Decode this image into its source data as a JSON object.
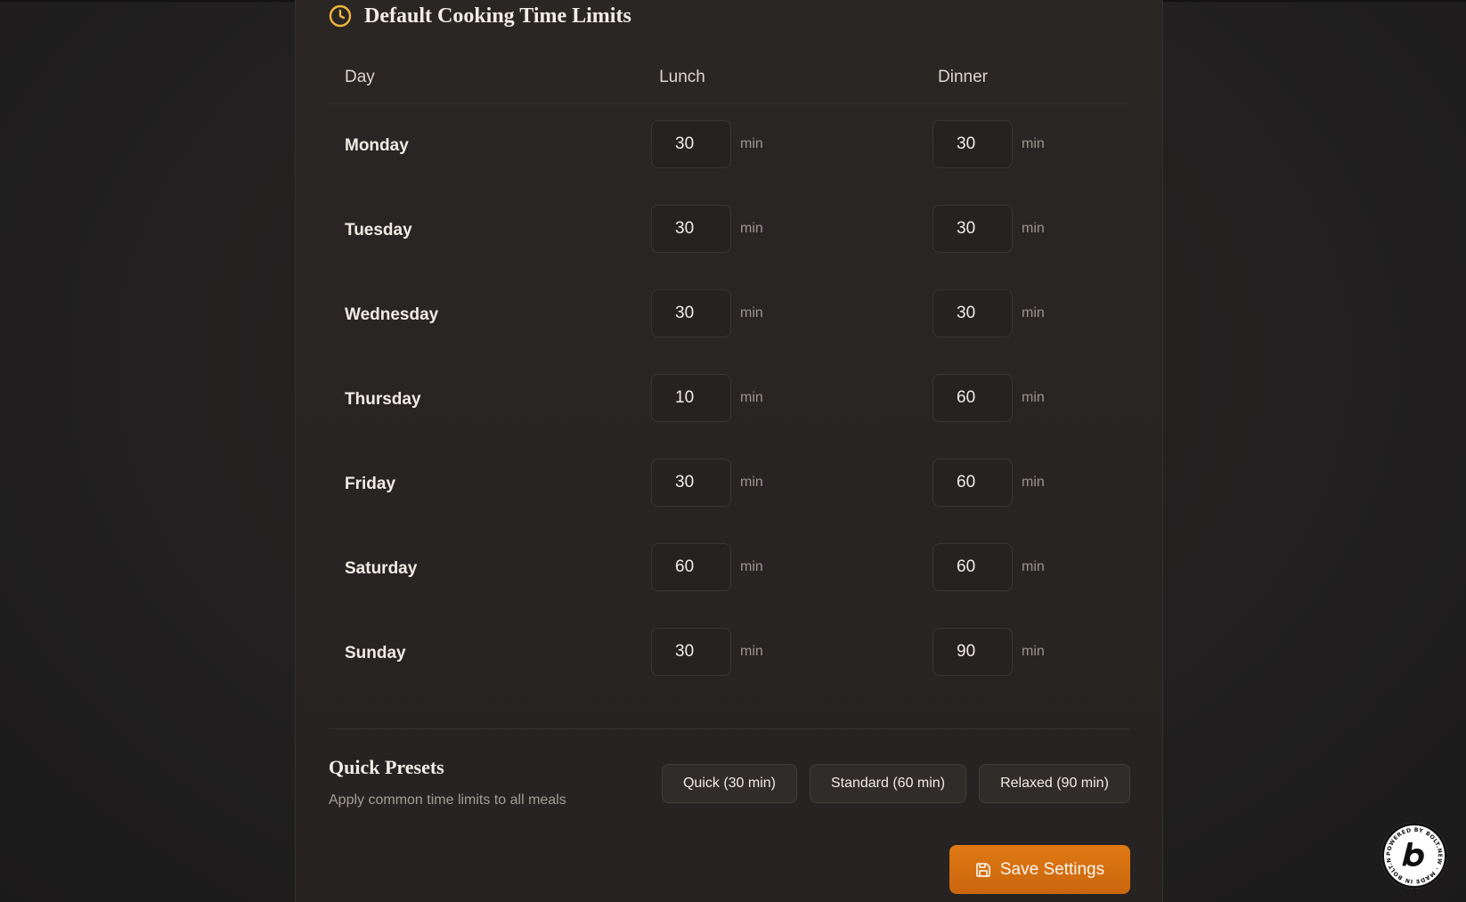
{
  "section": {
    "title": "Default Cooking Time Limits",
    "icon": "clock-icon",
    "accent_color": "#f2b33d"
  },
  "table": {
    "headers": {
      "day": "Day",
      "lunch": "Lunch",
      "dinner": "Dinner"
    },
    "unit": "min",
    "rows": [
      {
        "day": "Monday",
        "lunch": "30",
        "dinner": "30"
      },
      {
        "day": "Tuesday",
        "lunch": "30",
        "dinner": "30"
      },
      {
        "day": "Wednesday",
        "lunch": "30",
        "dinner": "30"
      },
      {
        "day": "Thursday",
        "lunch": "10",
        "dinner": "60"
      },
      {
        "day": "Friday",
        "lunch": "30",
        "dinner": "60"
      },
      {
        "day": "Saturday",
        "lunch": "60",
        "dinner": "60"
      },
      {
        "day": "Sunday",
        "lunch": "30",
        "dinner": "90"
      }
    ]
  },
  "presets": {
    "title": "Quick Presets",
    "subtitle": "Apply common time limits to all meals",
    "quick_label": "Quick (30 min)",
    "standard_label": "Standard (60 min)",
    "relaxed_label": "Relaxed (90 min)"
  },
  "save": {
    "label": "Save Settings",
    "icon": "save-icon",
    "color": "#d96f10"
  },
  "badge": {
    "icon": "bolt-logo-icon",
    "text": "POWERED BY BOLT.NEW · MADE IN BOLT.NEW"
  }
}
